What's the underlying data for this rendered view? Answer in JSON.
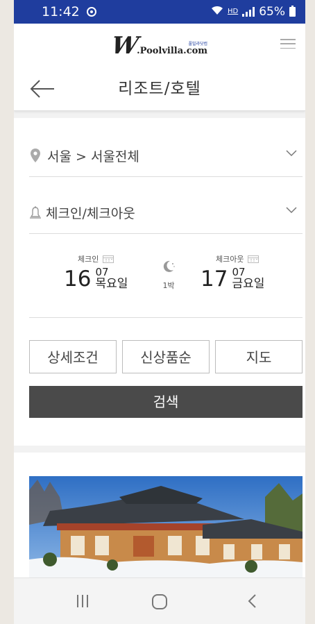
{
  "status_bar": {
    "time": "11:42",
    "hd": "HD",
    "battery": "65%"
  },
  "brand": {
    "logo_letter": "W",
    "logo_name": ".Poolvilla.com",
    "logo_korean": "풀빌라닷컴"
  },
  "header": {
    "title": "리조트/호텔"
  },
  "search": {
    "location": "서울 > 서울전체",
    "dates_field": "체크인/체크아웃",
    "checkin": {
      "label": "체크인",
      "day": "16",
      "month": "07",
      "weekday": "목요일"
    },
    "nights": "1박",
    "checkout": {
      "label": "체크아웃",
      "day": "17",
      "month": "07",
      "weekday": "금요일"
    },
    "options": [
      "상세조건",
      "신상품순",
      "지도"
    ],
    "search_button": "검색"
  },
  "colors": {
    "status_bar": "#1f3d9e",
    "search_button": "#4a4a4a"
  },
  "icons": {
    "location": "map-pin-icon",
    "dates": "bell-icon",
    "dropdown": "chevron-down-icon",
    "back": "arrow-left-icon",
    "menu": "hamburger-menu-icon",
    "nights": "moon-icon"
  }
}
